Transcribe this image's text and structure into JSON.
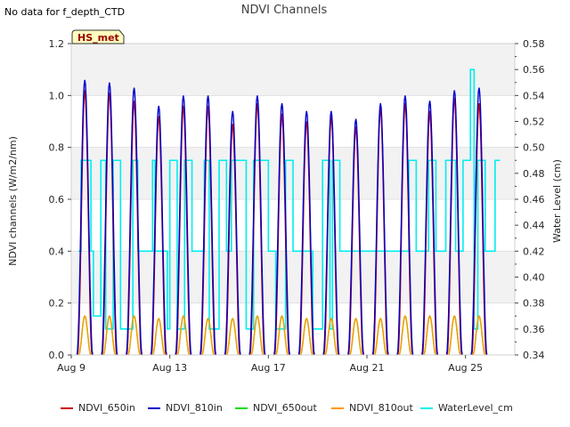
{
  "corner_note": "No data for f_depth_CTD",
  "colors": {
    "NDVI_650in": "#cc0000",
    "NDVI_810in": "#0000cc",
    "NDVI_650out": "#00dd00",
    "NDVI_810out": "#ff9900",
    "WaterLevel_cm": "#00eeee",
    "band": "#f2f2f2"
  },
  "chart_data": {
    "type": "line",
    "title": "NDVI Channels",
    "xlabel": "",
    "ylabel": "NDVI channels (W/m2/nm)",
    "y2label": "Water Level (cm)",
    "site_badge": "HS_met",
    "xlim": [
      0,
      18
    ],
    "ylim": [
      0,
      1.2
    ],
    "y2lim": [
      0.34,
      0.58
    ],
    "x_ticks": [
      {
        "x": 0,
        "label": "Aug 9"
      },
      {
        "x": 4,
        "label": "Aug 13"
      },
      {
        "x": 8,
        "label": "Aug 17"
      },
      {
        "x": 12,
        "label": "Aug 21"
      },
      {
        "x": 16,
        "label": "Aug 25"
      }
    ],
    "y_ticks": [
      "0.0",
      "0.2",
      "0.4",
      "0.6",
      "0.8",
      "1.0",
      "1.2"
    ],
    "y2_ticks": [
      "0.34",
      "0.36",
      "0.38",
      "0.40",
      "0.42",
      "0.44",
      "0.46",
      "0.48",
      "0.50",
      "0.52",
      "0.54",
      "0.56",
      "0.58"
    ],
    "grid": "horizontal bands",
    "legend_position": "bottom",
    "legend": [
      "NDVI_650in",
      "NDVI_810in",
      "NDVI_650out",
      "NDVI_810out",
      "WaterLevel_cm"
    ],
    "daily_peaks": {
      "day_offset": [
        0.55,
        1.55,
        2.55,
        3.55,
        4.55,
        5.55,
        6.55,
        7.55,
        8.55,
        9.55,
        10.55,
        11.55,
        12.55,
        13.55,
        14.55,
        15.55,
        16.55
      ],
      "NDVI_810in": [
        1.06,
        1.05,
        1.03,
        0.96,
        1.0,
        1.0,
        0.94,
        1.0,
        0.97,
        0.94,
        0.94,
        0.91,
        0.97,
        1.0,
        0.98,
        1.02,
        1.03
      ],
      "NDVI_650in": [
        1.02,
        1.01,
        0.98,
        0.92,
        0.96,
        0.96,
        0.89,
        0.97,
        0.93,
        0.9,
        0.92,
        0.88,
        0.95,
        0.97,
        0.94,
        0.99,
        0.97
      ],
      "NDVI_650out": [
        0.15,
        0.15,
        0.15,
        0.14,
        0.15,
        0.14,
        0.14,
        0.15,
        0.15,
        0.14,
        0.14,
        0.14,
        0.14,
        0.15,
        0.15,
        0.15,
        0.15
      ],
      "NDVI_810out": [
        0.15,
        0.15,
        0.15,
        0.14,
        0.15,
        0.14,
        0.14,
        0.15,
        0.15,
        0.14,
        0.14,
        0.14,
        0.14,
        0.15,
        0.15,
        0.15,
        0.15
      ]
    },
    "water_level": {
      "x": [
        0.3,
        0.4,
        0.8,
        0.9,
        1.2,
        1.4,
        1.7,
        2.0,
        2.5,
        2.7,
        3.3,
        3.4,
        3.5,
        3.9,
        4.0,
        4.3,
        4.6,
        4.9,
        5.4,
        5.6,
        6.0,
        6.3,
        6.5,
        7.1,
        7.4,
        8.0,
        8.3,
        8.7,
        9.0,
        9.4,
        9.8,
        10.2,
        10.5,
        10.6,
        10.9,
        11.2,
        11.5,
        11.9,
        12.2,
        12.6,
        13.0,
        13.3,
        13.7,
        14.0,
        14.5,
        14.8,
        15.2,
        15.6,
        15.9,
        16.2,
        16.35,
        16.5,
        16.8,
        17.2,
        17.4
      ],
      "y": [
        0.42,
        0.49,
        0.42,
        0.37,
        0.49,
        0.36,
        0.49,
        0.36,
        0.49,
        0.42,
        0.49,
        0.42,
        0.42,
        0.36,
        0.49,
        0.36,
        0.49,
        0.42,
        0.49,
        0.36,
        0.49,
        0.42,
        0.49,
        0.36,
        0.49,
        0.42,
        0.36,
        0.49,
        0.42,
        0.42,
        0.36,
        0.49,
        0.36,
        0.49,
        0.42,
        0.42,
        0.42,
        0.42,
        0.42,
        0.42,
        0.42,
        0.42,
        0.49,
        0.42,
        0.49,
        0.42,
        0.49,
        0.42,
        0.49,
        0.56,
        0.36,
        0.49,
        0.42,
        0.49,
        0.49
      ]
    }
  }
}
